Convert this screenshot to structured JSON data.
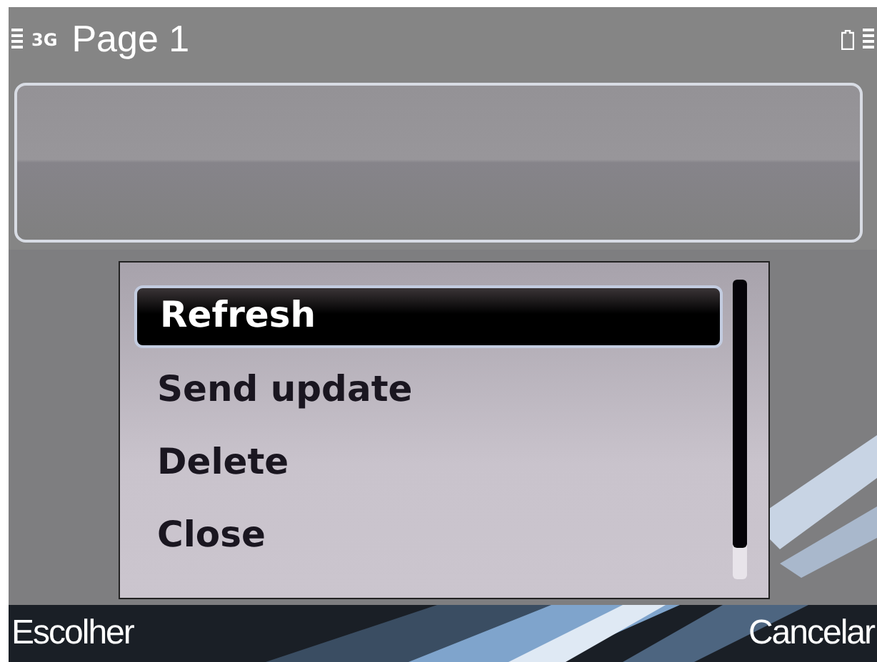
{
  "status_bar": {
    "network": "3G"
  },
  "title": "Page 1",
  "menu": {
    "items": [
      {
        "label": "Refresh",
        "selected": true
      },
      {
        "label": "Send update",
        "selected": false
      },
      {
        "label": "Delete",
        "selected": false
      },
      {
        "label": "Close",
        "selected": false
      }
    ]
  },
  "softkeys": {
    "left": "Escolher",
    "right": "Cancelar"
  }
}
